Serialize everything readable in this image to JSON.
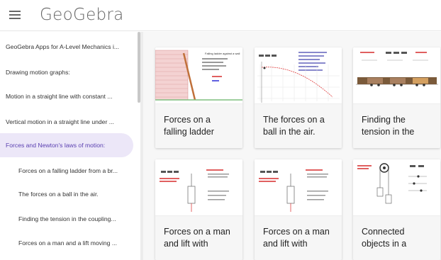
{
  "app": {
    "logo_text": "GeoGebra"
  },
  "sidebar": {
    "items": [
      {
        "label": "GeoGebra Apps for A-Level Mechanics i..."
      },
      {
        "label": "Drawing motion graphs:"
      },
      {
        "label": "Motion in a straight line with constant ..."
      },
      {
        "label": "Vertical motion in a straight line under ..."
      },
      {
        "label": "Forces and Newton's laws of motion:"
      },
      {
        "label": "Forces on a falling ladder from a br..."
      },
      {
        "label": "The forces on a ball in the air."
      },
      {
        "label": "Finding the tension in the coupling..."
      },
      {
        "label": "Forces on a man and a lift moving ..."
      }
    ]
  },
  "cards": [
    {
      "title": "Forces on a falling ladder",
      "thumb_heading": "Falling ladder against a wall"
    },
    {
      "title": "The forces on a ball in the air.",
      "thumb_heading": ""
    },
    {
      "title": "Finding the tension in the",
      "thumb_heading": ""
    },
    {
      "title": "Forces on a man and lift with",
      "thumb_heading": ""
    },
    {
      "title": "Forces on a man and lift with",
      "thumb_heading": ""
    },
    {
      "title": "Connected objects in a",
      "thumb_heading": ""
    }
  ],
  "colors": {
    "accent": "#5a3fb0",
    "active_bg": "#ece7f8"
  }
}
